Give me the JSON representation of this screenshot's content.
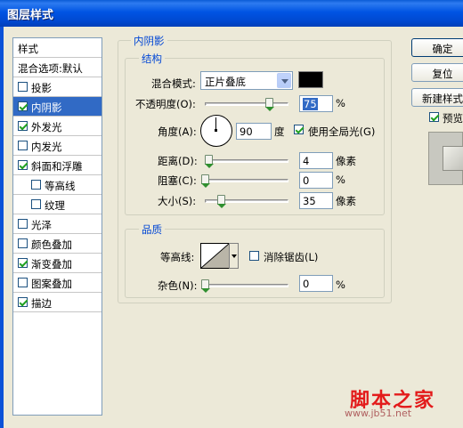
{
  "window": {
    "title": "图层样式"
  },
  "style_list": {
    "header": "样式",
    "blend_options": "混合选项:默认",
    "items": [
      {
        "label": "投影",
        "checked": false,
        "selected": false,
        "sub": false
      },
      {
        "label": "内阴影",
        "checked": true,
        "selected": true,
        "sub": false
      },
      {
        "label": "外发光",
        "checked": true,
        "selected": false,
        "sub": false
      },
      {
        "label": "内发光",
        "checked": false,
        "selected": false,
        "sub": false
      },
      {
        "label": "斜面和浮雕",
        "checked": true,
        "selected": false,
        "sub": false
      },
      {
        "label": "等高线",
        "checked": false,
        "selected": false,
        "sub": true
      },
      {
        "label": "纹理",
        "checked": false,
        "selected": false,
        "sub": true
      },
      {
        "label": "光泽",
        "checked": false,
        "selected": false,
        "sub": false
      },
      {
        "label": "颜色叠加",
        "checked": false,
        "selected": false,
        "sub": false
      },
      {
        "label": "渐变叠加",
        "checked": true,
        "selected": false,
        "sub": false
      },
      {
        "label": "图案叠加",
        "checked": false,
        "selected": false,
        "sub": false
      },
      {
        "label": "描边",
        "checked": true,
        "selected": false,
        "sub": false
      }
    ]
  },
  "inner_shadow": {
    "title": "内阴影",
    "structure": {
      "title": "结构",
      "blend_mode_label": "混合模式:",
      "blend_mode_value": "正片叠底",
      "shadow_color": "#000000",
      "opacity_label": "不透明度(O):",
      "opacity_value": "75",
      "opacity_unit": "%",
      "angle_label": "角度(A):",
      "angle_value": "90",
      "angle_unit": "度",
      "global_light_label": "使用全局光(G)",
      "global_light_checked": true,
      "distance_label": "距离(D):",
      "distance_value": "4",
      "distance_unit": "像素",
      "choke_label": "阻塞(C):",
      "choke_value": "0",
      "choke_unit": "%",
      "size_label": "大小(S):",
      "size_value": "35",
      "size_unit": "像素"
    },
    "quality": {
      "title": "品质",
      "contour_label": "等高线:",
      "anti_alias_label": "消除锯齿(L)",
      "anti_alias_checked": false,
      "noise_label": "杂色(N):",
      "noise_value": "0",
      "noise_unit": "%"
    }
  },
  "buttons": {
    "ok": "确定",
    "reset": "复位",
    "new_style": "新建样式",
    "preview_label": "预览",
    "preview_checked": true
  },
  "watermark": {
    "line1": "脚本之家",
    "line2": "www.jb51.net"
  }
}
